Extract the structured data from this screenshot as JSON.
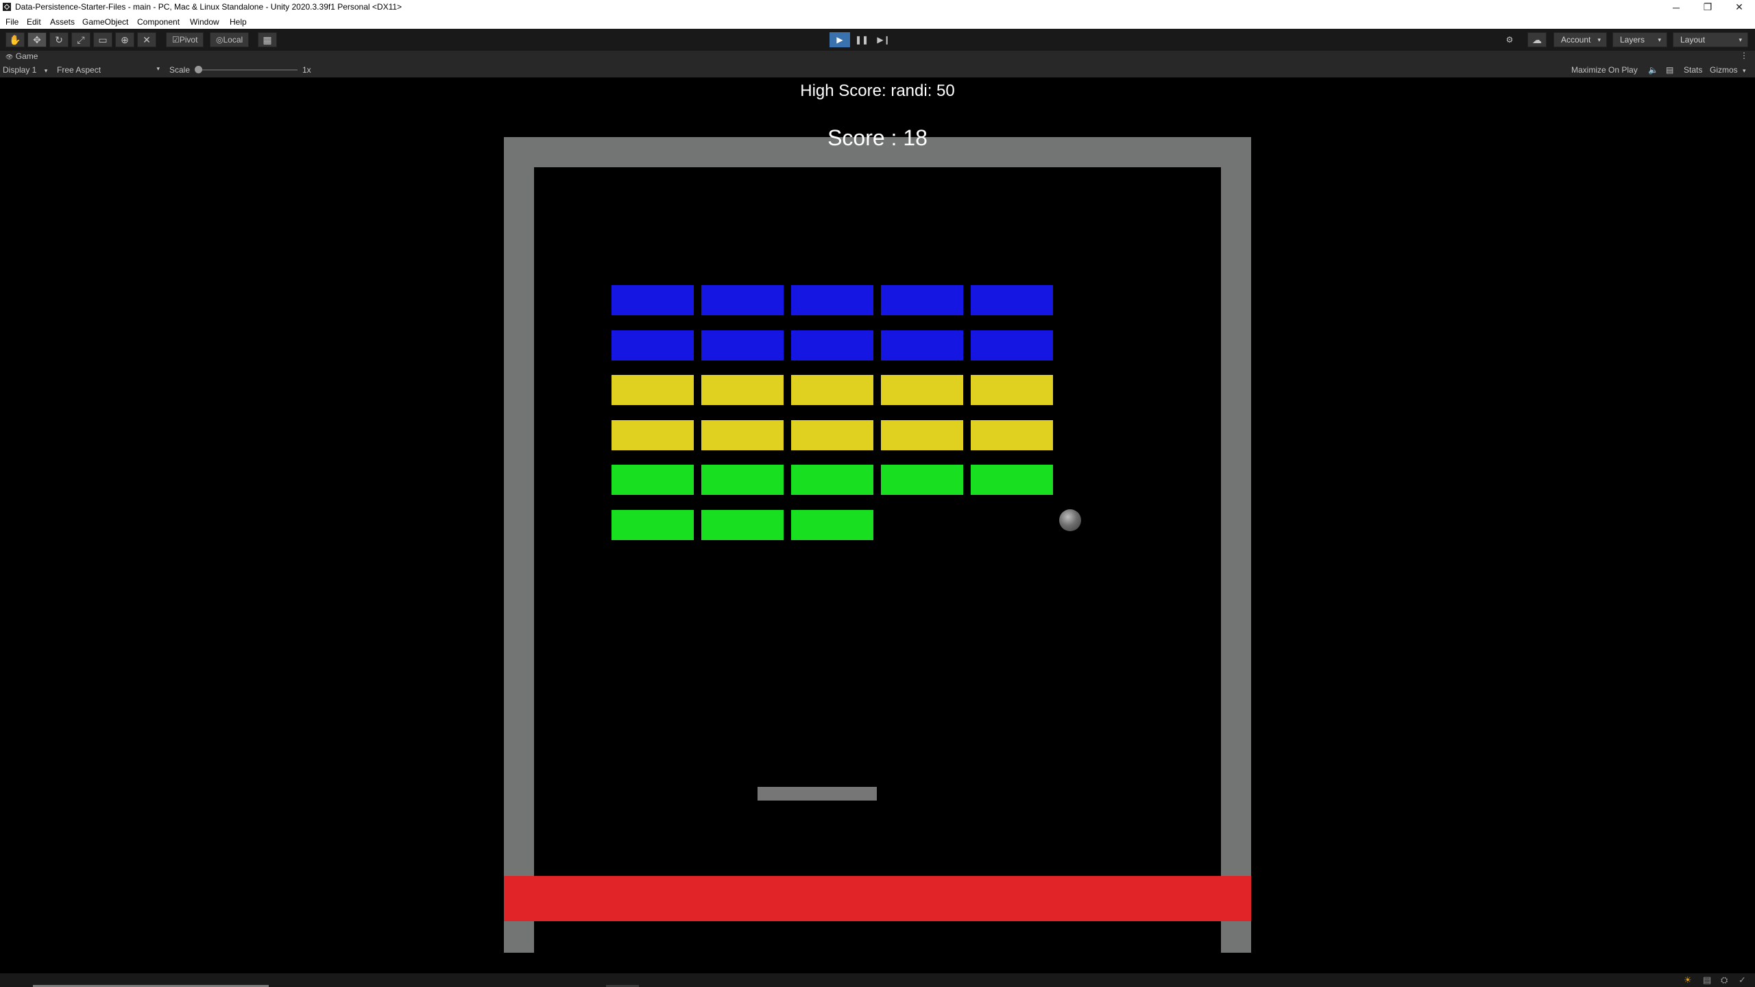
{
  "window": {
    "title": "Data-Persistence-Starter-Files - main - PC, Mac & Linux Standalone - Unity 2020.3.39f1 Personal <DX11>",
    "minimize_glyph": "─",
    "restore_glyph": "❐",
    "close_glyph": "✕"
  },
  "menu": [
    "File",
    "Edit",
    "Assets",
    "GameObject",
    "Component",
    "Window",
    "Help"
  ],
  "toolbar": {
    "tool_icons": [
      "hand-tool-icon",
      "move-tool-icon",
      "rotate-tool-icon",
      "scale-tool-icon",
      "rect-tool-icon",
      "transform-tool-icon",
      "custom-tool-icon"
    ],
    "tool_glyphs": [
      "✋",
      "✥",
      "↻",
      "⤢",
      "▭",
      "⊕",
      "✕"
    ],
    "pivot_label": "Pivot",
    "local_label": "Local",
    "grid_glyph": "▦",
    "play_glyph": "▶",
    "pause_glyph": "❚❚",
    "step_glyph": "▶❙",
    "collab_glyph": "⚙",
    "cloud_glyph": "☁",
    "account_label": "Account",
    "layers_label": "Layers",
    "layout_label": "Layout",
    "caret_glyph": "▾",
    "play_active": true
  },
  "game_view": {
    "tab_label": "Game",
    "tab_icon_glyph": "👁",
    "more_glyph": "⋮",
    "display_label": "Display 1",
    "aspect_label": "Free Aspect",
    "scale_label": "Scale",
    "scale_value": "1x",
    "scale_level": 0,
    "maximize_label": "Maximize On Play",
    "mute_glyph": "🔈",
    "stats_label": "Stats",
    "gizmos_label": "Gizmos",
    "caret_glyph": "▾"
  },
  "game": {
    "high_score_text": "High Score: randi: 50",
    "score_text": "Score : 18",
    "colors": {
      "wall": "#737574",
      "deadzone": "#e02428",
      "paddle": "#767676",
      "blue": "#1616e2",
      "yellow": "#e0d020",
      "green": "#18e020",
      "ball": "#6e6e6e",
      "text": "#ffffff"
    },
    "brick_rows": [
      [
        "blue",
        "blue",
        "blue",
        "blue",
        "blue"
      ],
      [
        "blue",
        "blue",
        "blue",
        "blue",
        "blue"
      ],
      [
        "yellow",
        "yellow",
        "yellow",
        "yellow",
        "yellow"
      ],
      [
        "yellow",
        "yellow",
        "yellow",
        "yellow",
        "yellow"
      ],
      [
        "green",
        "green",
        "green",
        "green",
        "green"
      ],
      [
        "green",
        "green",
        "green",
        null,
        null
      ]
    ]
  },
  "statusbar": {
    "icons": [
      "lighting-icon",
      "cache-icon",
      "network-icon",
      "check-icon"
    ],
    "glyphs": [
      "☀",
      "▤",
      "⛭",
      "✓"
    ]
  }
}
